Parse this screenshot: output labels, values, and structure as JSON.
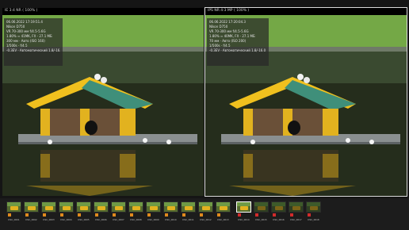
{
  "left_pane": {
    "title": "IE 3:4 NR ( 100% )",
    "exif": [
      "06.06.2022 17:19:51.4",
      "Nikon D750",
      "VR 70-300 мм f/4.5-5.6G",
      "1.80% ≈ 41MK, FX - 27.1 MБ",
      "300 мм · Авто (ISO 160)",
      "1/500s · f/4.5",
      "-0.3EV · Автоматический 1.8/-16.0"
    ]
  },
  "right_pane": {
    "title": "IPS NR 4:3 MP ( 100% )",
    "exif": [
      "06.06.2022 17:20:04.3",
      "Nikon D750",
      "VR 70-300 мм f/4.5-5.6G",
      "1.80% ≈ 40MK, FX - 27.1 MБ",
      "70 мм · Авто (ISO 200)",
      "1/500s · f/4.5",
      "-0.3EV · Автоматический 1.8/-16.0"
    ]
  },
  "filmstrip": {
    "thumbs": [
      {
        "label": "DSC_0001",
        "flag": "orange"
      },
      {
        "label": "DSC_0002",
        "flag": "orange"
      },
      {
        "label": "DSC_0003",
        "flag": "orange"
      },
      {
        "label": "DSC_0004",
        "flag": "orange"
      },
      {
        "label": "DSC_0005",
        "flag": "orange"
      },
      {
        "label": "DSC_0006",
        "flag": "orange"
      },
      {
        "label": "DSC_0007",
        "flag": "orange"
      },
      {
        "label": "DSC_0008",
        "flag": "orange"
      },
      {
        "label": "DSC_0009",
        "flag": "orange"
      },
      {
        "label": "DSC_0010",
        "flag": "orange"
      },
      {
        "label": "DSC_0011",
        "flag": "orange"
      },
      {
        "label": "DSC_0012",
        "flag": "orange"
      },
      {
        "label": "DSC_0013",
        "flag": "orange"
      },
      {
        "label": "DSC_0014",
        "flag": "red"
      },
      {
        "label": "DSC_0015",
        "flag": "red"
      },
      {
        "label": "DSC_0016",
        "flag": "red"
      },
      {
        "label": "DSC_0017",
        "flag": "red"
      },
      {
        "label": "DSC_0018",
        "flag": "red"
      }
    ]
  }
}
